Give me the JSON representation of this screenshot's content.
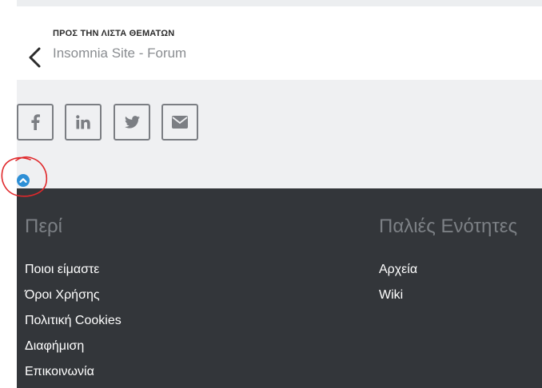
{
  "back": {
    "eyebrow": "ΠΡΟΣ ΤΗΝ ΛΙΣΤΑ ΘΕΜΑΤΩΝ",
    "title": "Insomnia Site - Forum"
  },
  "share": {
    "buttons": [
      {
        "icon": "facebook-icon"
      },
      {
        "icon": "linkedin-icon"
      },
      {
        "icon": "twitter-icon"
      },
      {
        "icon": "email-icon"
      }
    ]
  },
  "scroll_top": {
    "icon": "chevron-up-icon",
    "color": "#2e8fd6"
  },
  "annotation": {
    "color": "#e0282b"
  },
  "footer": {
    "col1": {
      "title": "Περί",
      "links": [
        "Ποιοι είμαστε",
        "Όροι Χρήσης",
        "Πολιτική Cookies",
        "Διαφήμιση",
        "Επικοινωνία"
      ]
    },
    "col2": {
      "title": "Παλιές Ενότητες",
      "links": [
        "Αρχεία",
        "Wiki"
      ]
    }
  },
  "colors": {
    "footer_bg": "#33363a",
    "share_bg": "#eff0f2",
    "icon_gray": "#7b7e83"
  }
}
